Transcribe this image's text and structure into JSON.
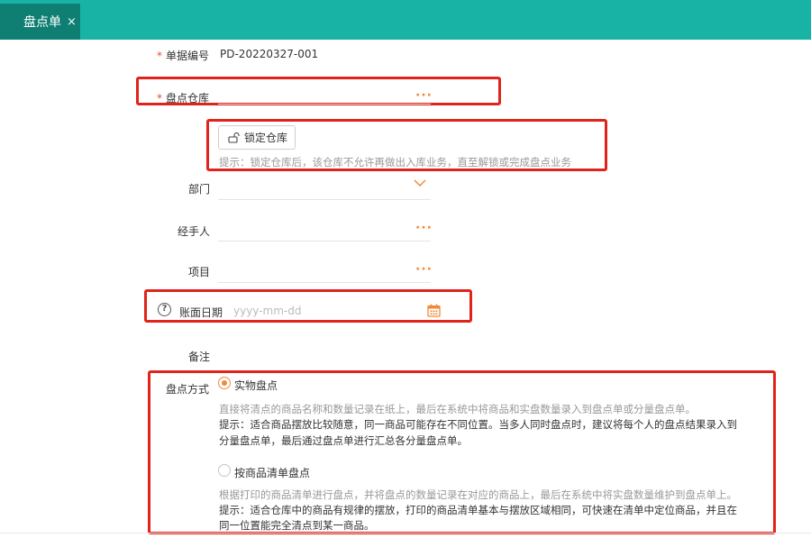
{
  "tab": {
    "title": "盘点单",
    "close": "×"
  },
  "fields": {
    "doc_no": {
      "label": "单据编号",
      "value": "PD-20220327-001"
    },
    "warehouse": {
      "label": "盘点仓库",
      "more": "···"
    },
    "lock": {
      "button": "锁定仓库",
      "hint": "提示：锁定仓库后，该仓库不允许再做出入库业务，直至解锁或完成盘点业务"
    },
    "dept": {
      "label": "部门"
    },
    "handler": {
      "label": "经手人",
      "more": "···"
    },
    "project": {
      "label": "项目",
      "more": "···"
    },
    "book_date": {
      "label": "账面日期",
      "placeholder": "yyyy-mm-dd",
      "help": "?"
    },
    "remark": {
      "label": "备注"
    },
    "method": {
      "label": "盘点方式",
      "options": [
        {
          "label": "实物盘点",
          "selected": true,
          "desc": "直接将清点的商品名称和数量记录在纸上，最后在系统中将商品和实盘数量录入到盘点单或分量盘点单。",
          "tip1": "提示：适合商品摆放比较随意，同一商品可能存在不同位置。当多人同时盘点时，建议将每个人的盘点结果录入到",
          "tip2": "分量盘点单，最后通过盘点单进行汇总各分量盘点单。"
        },
        {
          "label": "按商品清单盘点",
          "selected": false,
          "desc": "根据打印的商品清单进行盘点，并将盘点的数量记录在对应的商品上，最后在系统中将实盘数量维护到盘点单上。",
          "tip1": "提示：适合仓库中的商品有规律的摆放，打印的商品清单基本与摆放区域相同，可快速在清单中定位商品，并且在",
          "tip2": "同一位置能完全清点到某一商品。"
        }
      ]
    }
  },
  "colors": {
    "accent": "#f08a3b",
    "header": "#19b3a6",
    "tab_active": "#0f7f74",
    "annotation": "#e0241b"
  }
}
